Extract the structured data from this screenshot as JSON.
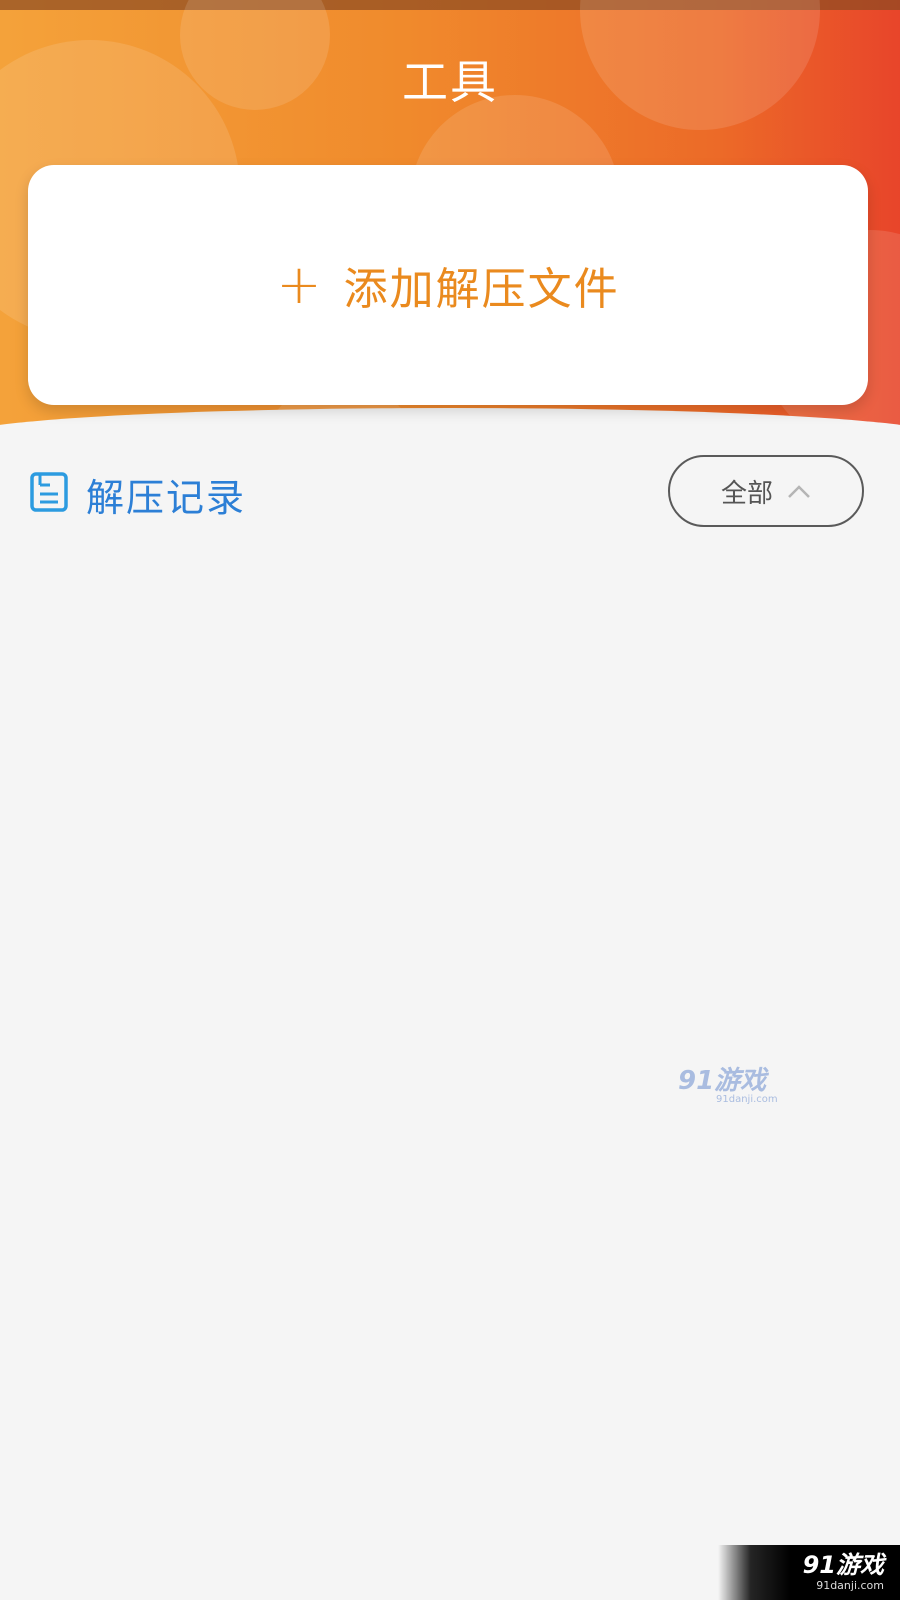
{
  "header": {
    "title": "工具",
    "gradient_colors": [
      "#f4a23a",
      "#f08a2c",
      "#ec6a28",
      "#e8452a"
    ]
  },
  "add_card": {
    "plus_icon": "+",
    "label": "添加解压文件",
    "accent_color": "#ea8a1e"
  },
  "records": {
    "icon": "document-list-icon",
    "title": "解压记录",
    "title_color": "#2c7fd6",
    "filter": {
      "label": "全部",
      "icon": "chevron-up-icon"
    }
  },
  "watermark": {
    "main": "91游戏",
    "sub": "91danji.com"
  },
  "corner_logo": {
    "main": "91游戏",
    "sub": "91danji.com"
  }
}
